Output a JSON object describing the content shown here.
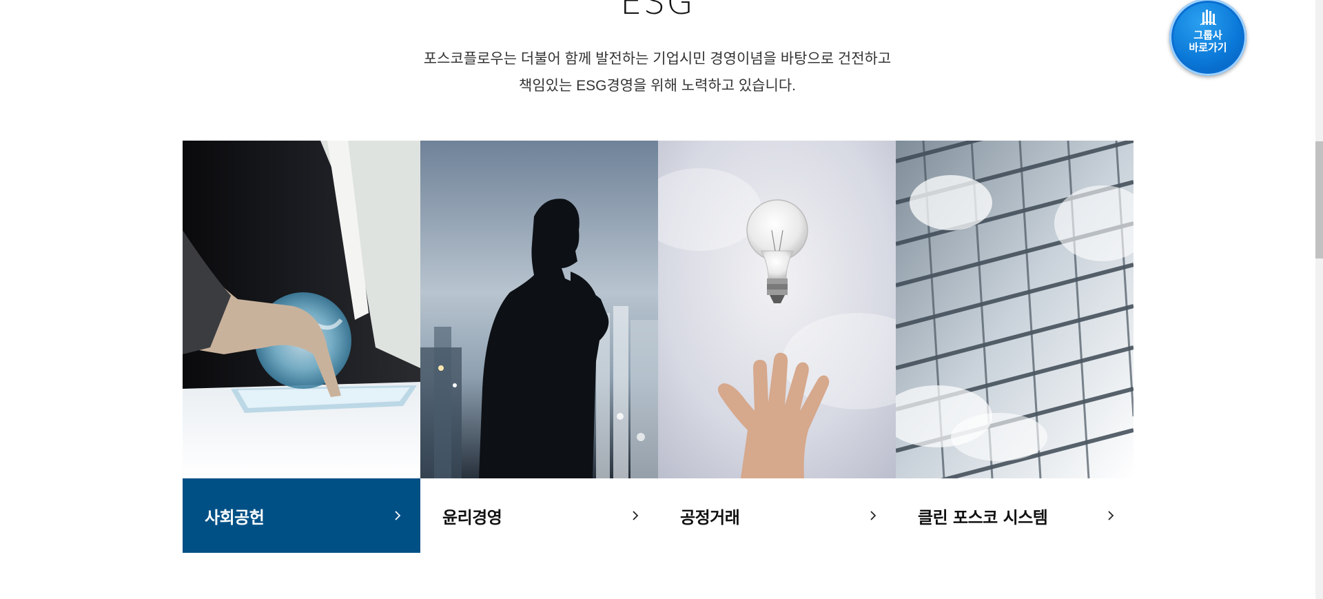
{
  "section": {
    "title": "ESG",
    "description_lines": [
      "포스코플로우는 더불어 함께 발전하는 기업시민 경영이념을 바탕으로 건전하고",
      "책임있는 ESG경영을 위해 노력하고 있습니다."
    ]
  },
  "group_badge": {
    "line1": "그룹사",
    "line2": "바로가기",
    "icon": "building-icon"
  },
  "cards": [
    {
      "label": "사회공헌",
      "active": true,
      "image": "hand-touching-globe-tablet",
      "arrow_icon": "chevron-right-icon"
    },
    {
      "label": "윤리경영",
      "active": false,
      "image": "thinking-man-silhouette-city",
      "arrow_icon": "chevron-right-icon"
    },
    {
      "label": "공정거래",
      "active": false,
      "image": "lightbulb-over-open-hand",
      "arrow_icon": "chevron-right-icon"
    },
    {
      "label": "클린 포스코 시스템",
      "active": false,
      "image": "glass-building-facade-clouds",
      "arrow_icon": "chevron-right-icon"
    }
  ],
  "colors": {
    "active_card_bg": "#005086",
    "badge_blue": "#0a78d8"
  }
}
